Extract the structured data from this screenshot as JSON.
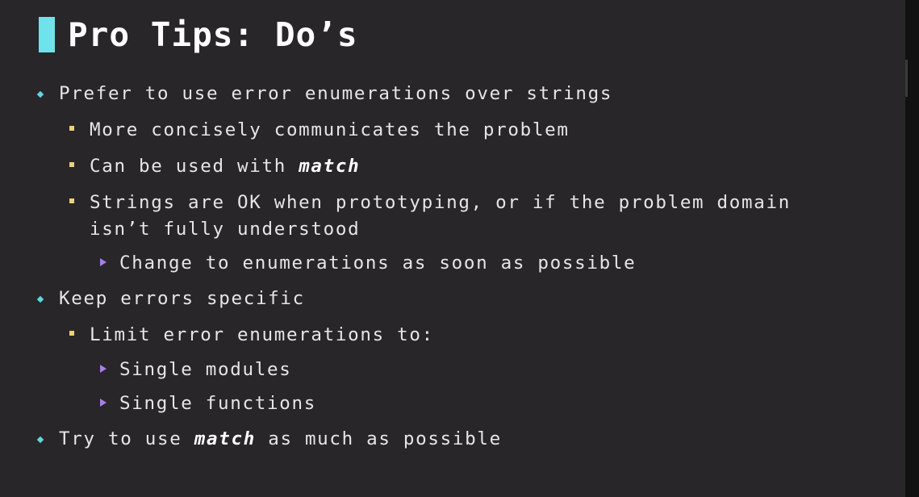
{
  "title": "Pro Tips: Do’s",
  "bullets": [
    {
      "level": 1,
      "text": "Prefer to use error enumerations over strings"
    },
    {
      "level": 2,
      "text": "More concisely communicates the problem"
    },
    {
      "level": 2,
      "text_before": "Can be used with ",
      "keyword": "match"
    },
    {
      "level": 2,
      "line1": "Strings are OK when prototyping, or if the problem domain",
      "line2": "isn’t fully understood"
    },
    {
      "level": 3,
      "text": "Change to enumerations as soon as possible"
    },
    {
      "level": 1,
      "text": "Keep errors specific"
    },
    {
      "level": 2,
      "text": "Limit error enumerations to:"
    },
    {
      "level": 3,
      "text": "Single modules"
    },
    {
      "level": 3,
      "text": "Single functions"
    },
    {
      "level": 1,
      "text_before": "Try to use ",
      "keyword": "match",
      "text_after": " as much as possible"
    }
  ],
  "colors": {
    "background": "#282629",
    "accent": "#6ee3ec",
    "level1_bullet": "#5fd6e0",
    "level2_bullet": "#e9d27a",
    "level3_bullet": "#a87ee8"
  }
}
